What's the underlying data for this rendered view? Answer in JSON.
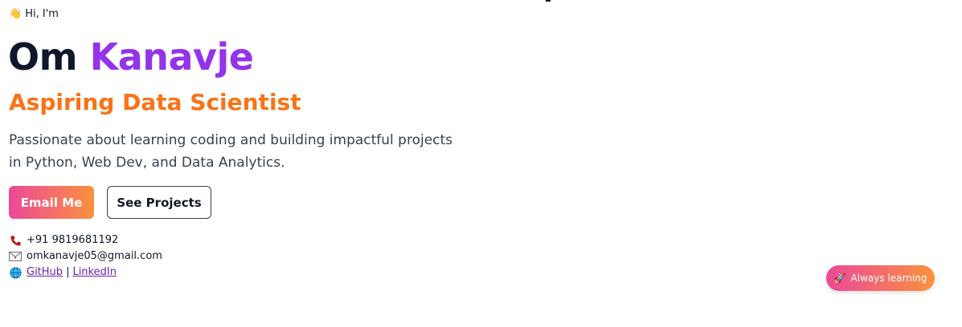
{
  "hero": {
    "greeting_icon": "waving-hand-icon",
    "greeting": "Hi, I'm",
    "first_name": "Om",
    "last_name": "Kanavje",
    "role": "Aspiring Data Scientist",
    "bio": "Passionate about learning coding and building impactful projects in Python, Web Dev, and Data Analytics."
  },
  "buttons": {
    "email_label": "Email Me",
    "projects_label": "See Projects"
  },
  "contact": {
    "phone_icon": "phone-icon",
    "phone": "+91 9819681192",
    "email_icon": "envelope-icon",
    "email": "omkanavje05@gmail.com",
    "web_icon": "globe-icon",
    "github_label": "GitHub",
    "separator": "|",
    "linkedin_label": "LinkedIn"
  },
  "badge": {
    "icon": "rocket-icon",
    "label": "Always learning"
  },
  "colors": {
    "name_accent": "#9333ea",
    "role": "#f97316",
    "gradient_start": "#ec4899",
    "gradient_end": "#fb923c",
    "link": "#6b21a8"
  }
}
